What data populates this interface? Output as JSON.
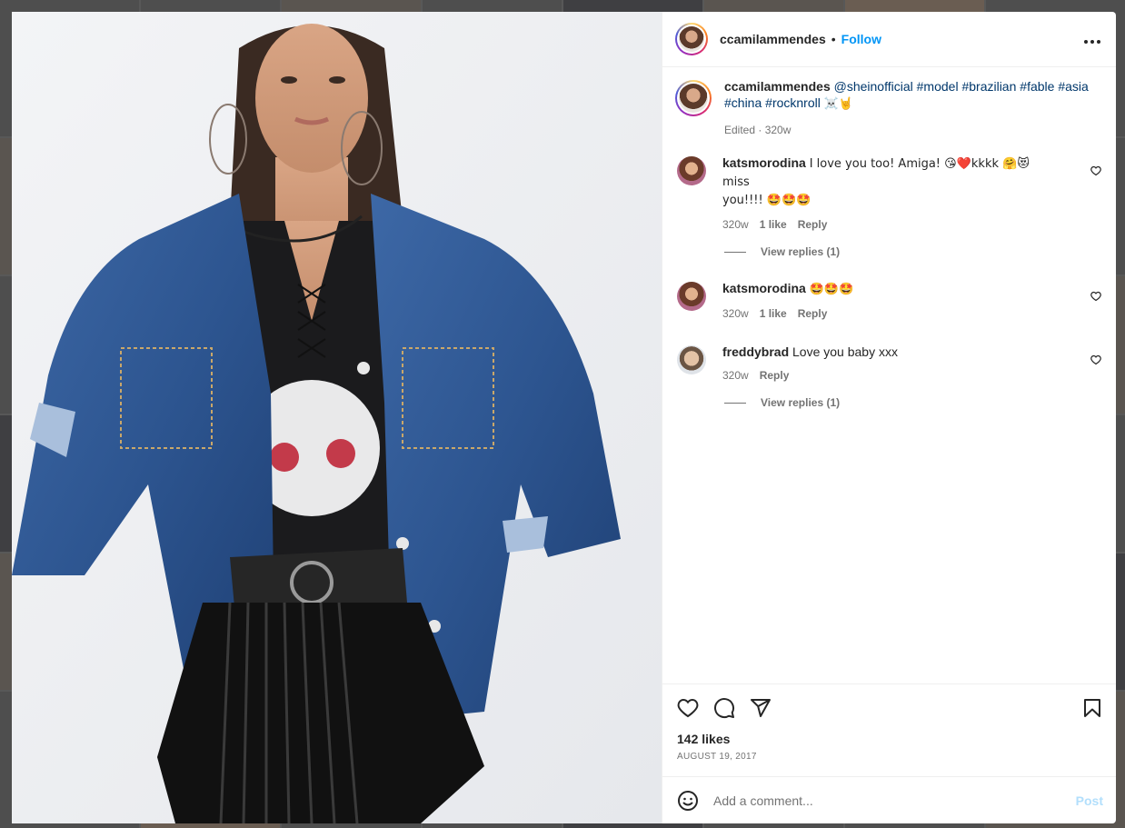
{
  "post": {
    "username": "ccamilammendes",
    "separator": "•",
    "follow_label": "Follow",
    "more_label": "•••",
    "image_alt": "Model wearing distressed denim jacket"
  },
  "caption": {
    "username": "ccamilammendes",
    "mention": "@sheinofficial",
    "hashtags": [
      "#model",
      "#brazilian",
      "#fable",
      "#asia",
      "#china",
      "#rocknroll"
    ],
    "emoji": "☠️🤘",
    "meta": "Edited · 320w"
  },
  "comments": [
    {
      "username": "katsmorodina",
      "text_a": "I love you too! Amiga! 😘❤️kkkk 🤗😻 miss",
      "text_b": "you!!!! 🤩🤩🤩",
      "time": "320w",
      "likes": "1 like",
      "reply": "Reply",
      "view_replies": "View replies (1)"
    },
    {
      "username": "katsmorodina",
      "text": "🤩🤩🤩",
      "time": "320w",
      "likes": "1 like",
      "reply": "Reply"
    },
    {
      "username": "freddybrad",
      "text": "Love you baby xxx",
      "time": "320w",
      "reply": "Reply",
      "view_replies": "View replies (1)"
    }
  ],
  "footer": {
    "likes": "142 likes",
    "date": "AUGUST 19, 2017",
    "comment_placeholder": "Add a comment...",
    "post_label": "Post"
  }
}
